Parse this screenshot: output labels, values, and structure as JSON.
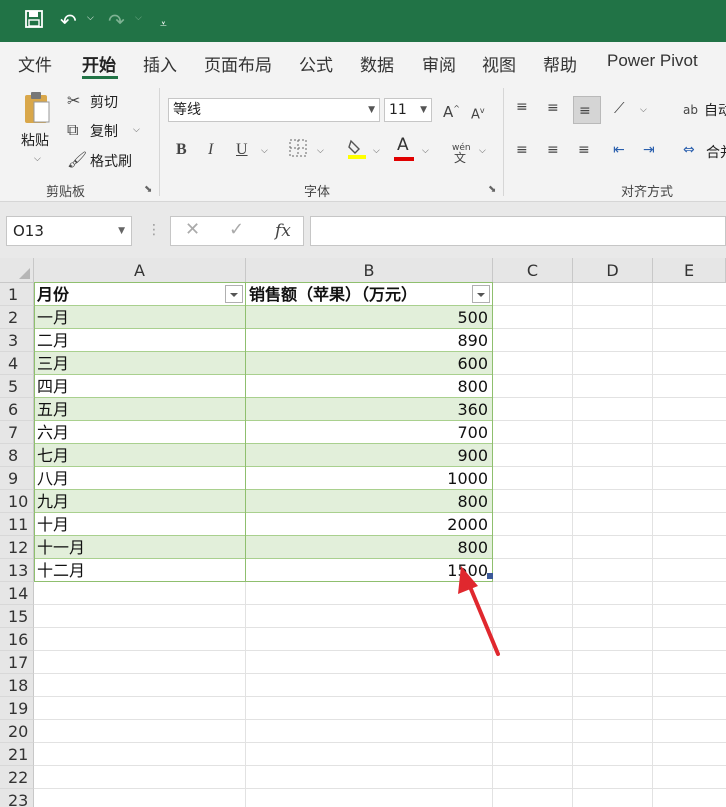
{
  "quick_access": {
    "save": "save-icon",
    "undo": "undo-icon",
    "redo": "redo-icon",
    "customize": "customize-icon"
  },
  "tabs": [
    "文件",
    "开始",
    "插入",
    "页面布局",
    "公式",
    "数据",
    "审阅",
    "视图",
    "帮助",
    "Power Pivot"
  ],
  "active_tab": "开始",
  "clipboard": {
    "paste": "粘贴",
    "cut": "剪切",
    "copy": "复制",
    "format_painter": "格式刷",
    "group": "剪贴板"
  },
  "font": {
    "name": "等线",
    "size": "11",
    "group": "字体",
    "bold": "B",
    "italic": "I",
    "underline": "U",
    "font_color_letter": "A",
    "phonetic": "wén",
    "highlight_color": "#ffff00",
    "font_color": "#e00000"
  },
  "alignment": {
    "group": "对齐方式",
    "wrap": "自动",
    "merge": "合并"
  },
  "name_box": "O13",
  "formula_buttons": {
    "cancel": "✕",
    "confirm": "✓",
    "fx": "fx"
  },
  "formula_value": "",
  "columns": [
    "A",
    "B",
    "C",
    "D",
    "E"
  ],
  "rows": [
    "1",
    "2",
    "3",
    "4",
    "5",
    "6",
    "7",
    "8",
    "9",
    "10",
    "11",
    "12",
    "13",
    "14",
    "15",
    "16",
    "17",
    "18",
    "19",
    "20",
    "21",
    "22",
    "23"
  ],
  "table": {
    "headers": [
      "月份",
      "销售额（苹果）（万元）"
    ],
    "rows": [
      [
        "一月",
        "500"
      ],
      [
        "二月",
        "890"
      ],
      [
        "三月",
        "600"
      ],
      [
        "四月",
        "800"
      ],
      [
        "五月",
        "360"
      ],
      [
        "六月",
        "700"
      ],
      [
        "七月",
        "900"
      ],
      [
        "八月",
        "1000"
      ],
      [
        "九月",
        "800"
      ],
      [
        "十月",
        "2000"
      ],
      [
        "十一月",
        "800"
      ],
      [
        "十二月",
        "1500"
      ]
    ],
    "band_color": "#e2efda",
    "border_color": "#8fbf6e"
  },
  "brand_color": "#217346",
  "annotation_arrow_color": "#e0282e"
}
